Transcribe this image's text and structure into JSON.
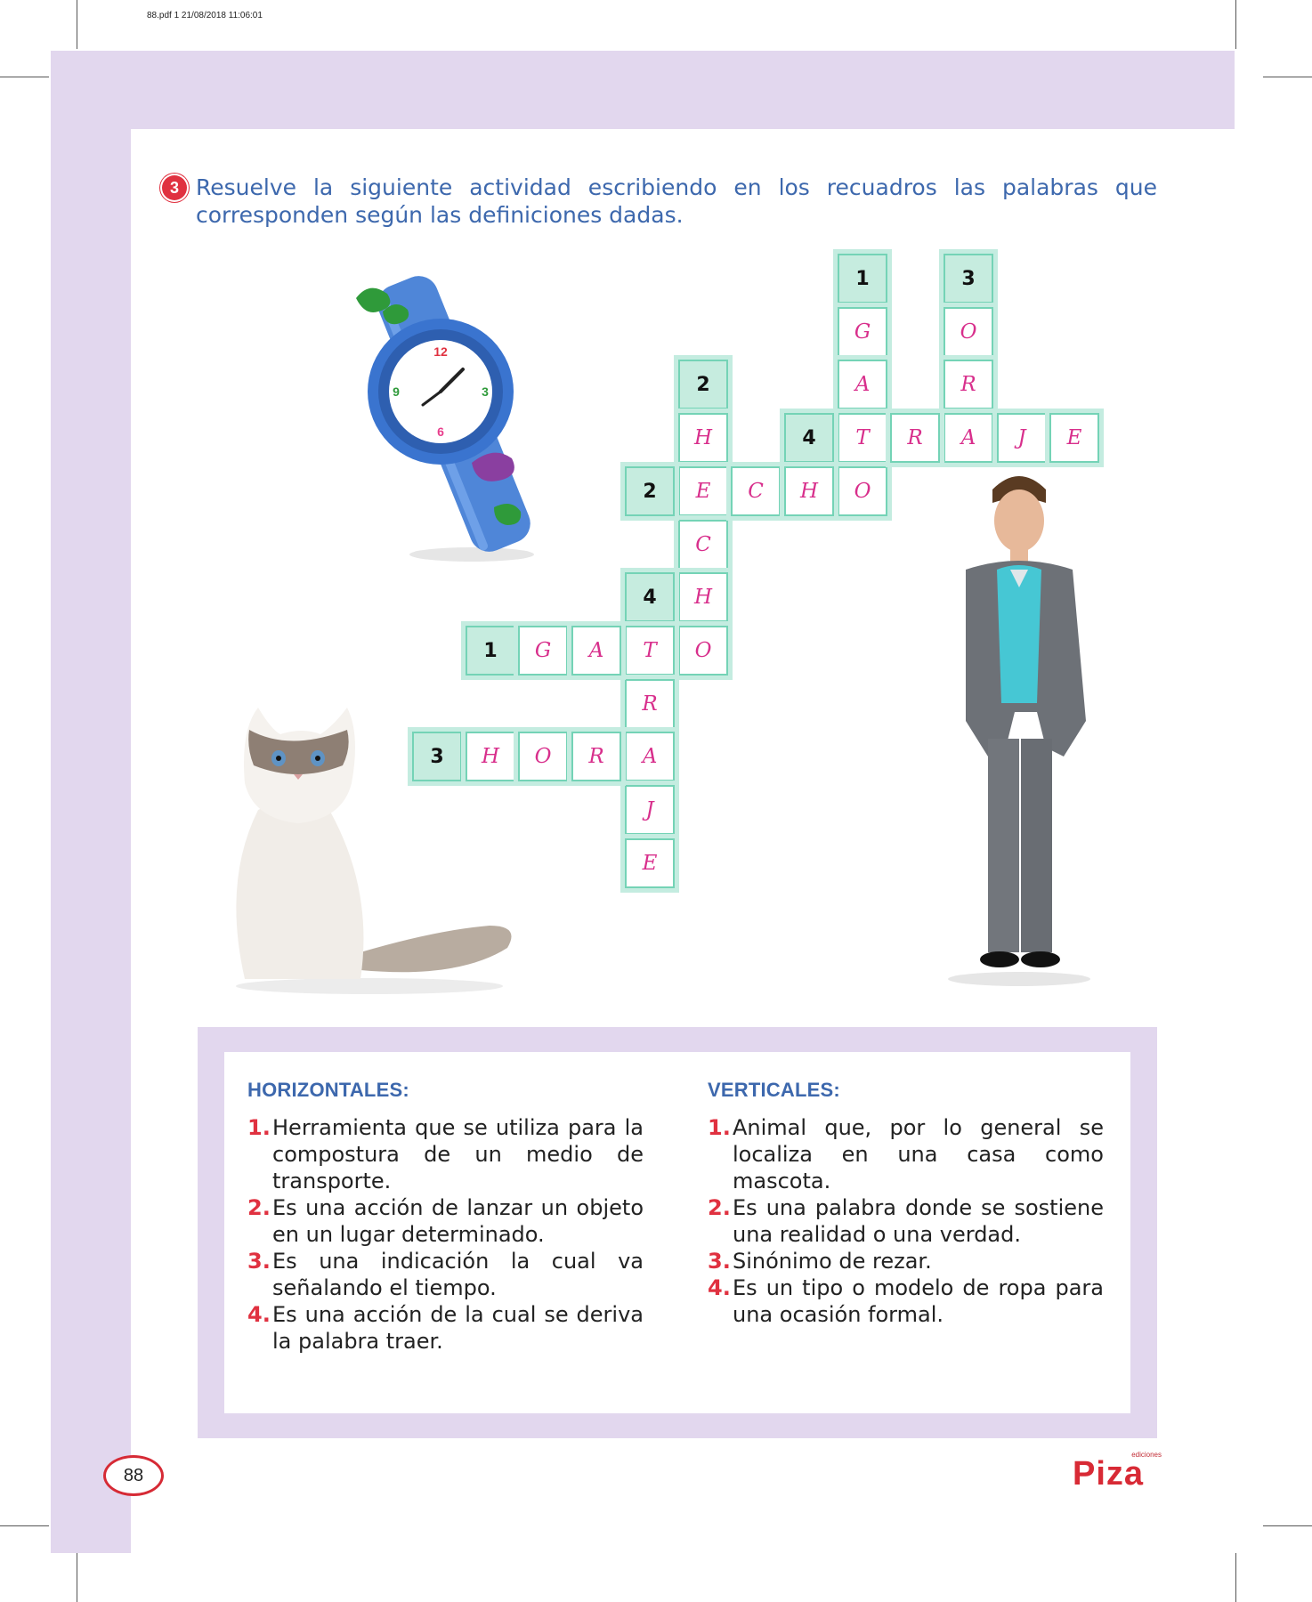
{
  "print_meta": "88.pdf   1   21/08/2018   11:06:01",
  "instruction": {
    "number": "3",
    "text": "Resuelve la siguiente actividad escribiendo en los recuadros las palabras que corresponden según las definiciones dadas."
  },
  "crossword": {
    "cells": [
      {
        "row": 0,
        "col": 8,
        "text": "1",
        "number": true
      },
      {
        "row": 1,
        "col": 8,
        "text": "G"
      },
      {
        "row": 2,
        "col": 8,
        "text": "A"
      },
      {
        "row": 3,
        "col": 8,
        "text": "T"
      },
      {
        "row": 4,
        "col": 8,
        "text": "O"
      },
      {
        "row": 0,
        "col": 10,
        "text": "3",
        "number": true
      },
      {
        "row": 1,
        "col": 10,
        "text": "O"
      },
      {
        "row": 2,
        "col": 10,
        "text": "R"
      },
      {
        "row": 3,
        "col": 10,
        "text": "A"
      },
      {
        "row": 3,
        "col": 7,
        "text": "4",
        "number": true
      },
      {
        "row": 3,
        "col": 9,
        "text": "R"
      },
      {
        "row": 3,
        "col": 11,
        "text": "J"
      },
      {
        "row": 3,
        "col": 12,
        "text": "E"
      },
      {
        "row": 2,
        "col": 5,
        "text": "2",
        "number": true
      },
      {
        "row": 3,
        "col": 5,
        "text": "H"
      },
      {
        "row": 4,
        "col": 5,
        "text": "E"
      },
      {
        "row": 5,
        "col": 5,
        "text": "C"
      },
      {
        "row": 6,
        "col": 5,
        "text": "H"
      },
      {
        "row": 7,
        "col": 5,
        "text": "O"
      },
      {
        "row": 4,
        "col": 4,
        "text": "2",
        "number": true
      },
      {
        "row": 4,
        "col": 6,
        "text": "C"
      },
      {
        "row": 4,
        "col": 7,
        "text": "H"
      },
      {
        "row": 6,
        "col": 4,
        "text": "4",
        "number": true
      },
      {
        "row": 7,
        "col": 4,
        "text": "T"
      },
      {
        "row": 8,
        "col": 4,
        "text": "R"
      },
      {
        "row": 9,
        "col": 4,
        "text": "A"
      },
      {
        "row": 10,
        "col": 4,
        "text": "J"
      },
      {
        "row": 11,
        "col": 4,
        "text": "E"
      },
      {
        "row": 7,
        "col": 1,
        "text": "1",
        "number": true
      },
      {
        "row": 7,
        "col": 2,
        "text": "G"
      },
      {
        "row": 7,
        "col": 3,
        "text": "A"
      },
      {
        "row": 9,
        "col": 0,
        "text": "3",
        "number": true
      },
      {
        "row": 9,
        "col": 1,
        "text": "H"
      },
      {
        "row": 9,
        "col": 2,
        "text": "O"
      },
      {
        "row": 9,
        "col": 3,
        "text": "R"
      }
    ]
  },
  "clues": {
    "horizontal": {
      "heading": "HORIZONTALES:",
      "items": [
        {
          "num": "1.",
          "text": "Herramienta que se utiliza para la compostura de un medio de transporte."
        },
        {
          "num": "2.",
          "text": "Es una acción de lanzar un objeto en un lugar determinado."
        },
        {
          "num": "3.",
          "text": "Es una indicación la cual va señalando el tiempo."
        },
        {
          "num": "4.",
          "text": "Es una acción de la cual se deriva la palabra traer."
        }
      ]
    },
    "vertical": {
      "heading": "VERTICALES:",
      "items": [
        {
          "num": "1.",
          "text": "Animal que, por lo general se localiza en una casa como mascota."
        },
        {
          "num": "2.",
          "text": "Es una palabra donde se sostiene una realidad o una verdad."
        },
        {
          "num": "3.",
          "text": "Sinónimo de rezar."
        },
        {
          "num": "4.",
          "text": "Es un tipo o modelo de ropa para una ocasión formal."
        }
      ]
    }
  },
  "page_number": "88",
  "logo": {
    "small": "ediciones",
    "main": "Piza"
  },
  "colors": {
    "frame": "#e2d7ee",
    "instruction_text": "#3d68ad",
    "accent_red": "#e03140",
    "cell_border": "#74d3b6",
    "cell_number_bg": "#c6ecdf",
    "letter_magenta": "#d82f8c"
  }
}
